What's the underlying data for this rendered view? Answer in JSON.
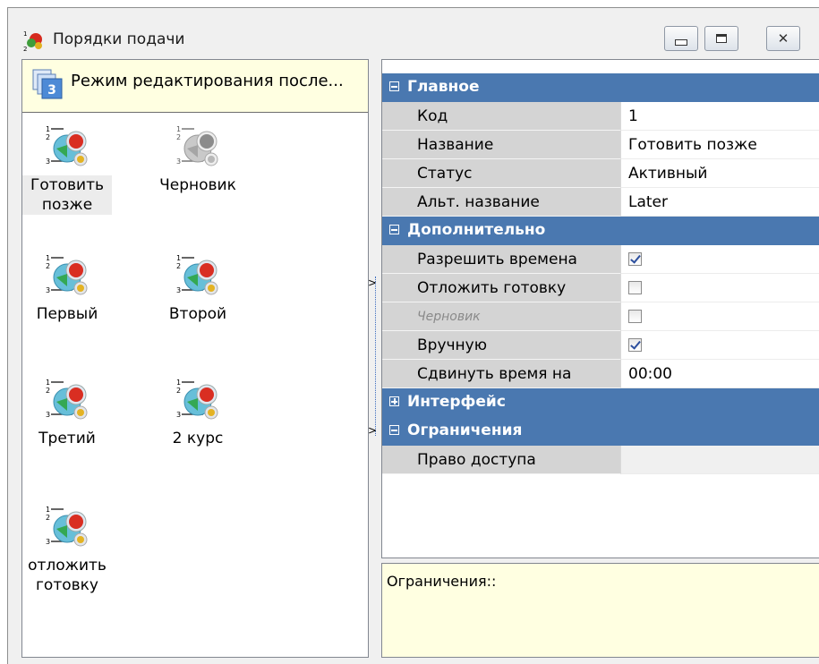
{
  "window": {
    "title": "Порядки подачи",
    "icon": "dishes-order-icon",
    "controls": [
      "minimize",
      "maximize",
      "close"
    ],
    "close_glyph": "✕"
  },
  "left_panel": {
    "mode_banner": {
      "text": "Режим редактирования после...",
      "icon": "edit-mode-3-icon"
    },
    "items": [
      {
        "label": "Готовить позже",
        "selected": true,
        "icon": "serving-order-icon"
      },
      {
        "label": "Черновик",
        "disabled": true,
        "icon": "serving-order-gray-icon"
      },
      {
        "label": "Первый",
        "icon": "serving-order-icon"
      },
      {
        "label": "Второй",
        "icon": "serving-order-icon"
      },
      {
        "label": "Третий",
        "icon": "serving-order-icon"
      },
      {
        "label": "2 курс",
        "icon": "serving-order-icon"
      },
      {
        "label": "отложить готовку",
        "icon": "serving-order-icon"
      }
    ]
  },
  "splitter": {
    "arrow": ">"
  },
  "property_grid": {
    "sections": [
      {
        "title": "Главное",
        "expanded": true,
        "props": [
          {
            "name": "Код",
            "value": "1"
          },
          {
            "name": "Название",
            "value": "Готовить позже"
          },
          {
            "name": "Статус",
            "value": "Активный"
          },
          {
            "name": "Альт. название",
            "value": "Later"
          }
        ]
      },
      {
        "title": "Дополнительно",
        "expanded": true,
        "props": [
          {
            "name": "Разрешить времена",
            "checked": true
          },
          {
            "name": "Отложить готовку",
            "checked": false
          },
          {
            "name": "Черновик",
            "checked": false,
            "disabled": true
          },
          {
            "name": "Вручную",
            "checked": true
          },
          {
            "name": "Сдвинуть время на",
            "value": "00:00"
          }
        ]
      },
      {
        "title": "Интерфейс",
        "expanded": false,
        "props": []
      },
      {
        "title": "Ограничения",
        "expanded": true,
        "props": [
          {
            "name": "Право доступа",
            "value": ""
          }
        ]
      }
    ]
  },
  "description": {
    "text": "Ограничения::"
  },
  "colors": {
    "category_header": "#4a78b0",
    "banner_background": "#ffffe1",
    "property_name_background": "#d4d4d4"
  }
}
